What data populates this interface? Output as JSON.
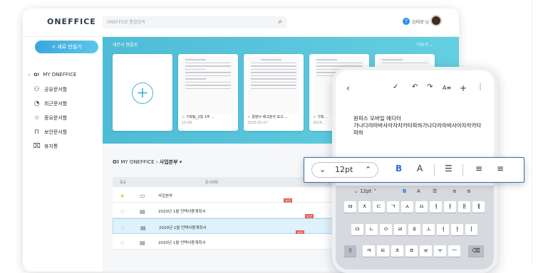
{
  "header": {
    "logo": "ONEFFICE",
    "search_placeholder": "ONEFFICE 통합검색",
    "user_name": "김태경 님"
  },
  "sidebar": {
    "new_button": "+ 새로 만들기",
    "items": [
      {
        "label": "MY ONEFFICE",
        "icon": "folder-icon"
      },
      {
        "label": "공유문서함",
        "icon": "users-icon"
      },
      {
        "label": "최근문서함",
        "icon": "clock-icon"
      },
      {
        "label": "중요문서함",
        "icon": "star-icon"
      },
      {
        "label": "보안문서함",
        "icon": "lock-icon"
      },
      {
        "label": "휴지통",
        "icon": "trash-icon"
      }
    ]
  },
  "templates": {
    "title": "새문서 템플릿",
    "more": "더보기",
    "cards": [
      {
        "caption": "기획팀_2월 1주 ...",
        "date": "15:09"
      },
      {
        "caption": "경영서 배고분석 보고 ...",
        "date": "2020.02.07"
      },
      {
        "caption": "기획...",
        "date": "2019..."
      }
    ]
  },
  "breadcrumb": {
    "root": "MY ONEFFICE",
    "current": "사업본부"
  },
  "table": {
    "headers": [
      "중요",
      "문서제목"
    ],
    "rows": [
      {
        "title": "사업본부",
        "starred": true,
        "type": "folder",
        "badges": [
          "공유",
          "보안"
        ],
        "selected": false
      },
      {
        "title": "2020년 1월 언택사용계획서",
        "starred": false,
        "type": "doc",
        "badges": [
          "보안"
        ],
        "selected": false
      },
      {
        "title": "2020년 1월 언택사용계획서",
        "starred": false,
        "type": "doc",
        "badges": [
          "공유",
          "보안"
        ],
        "selected": true
      },
      {
        "title": "2020년 1월 언택사용계획서",
        "starred": false,
        "type": "doc",
        "badges": [],
        "selected": false
      }
    ]
  },
  "mobile": {
    "text_line1": "원피스 모바일 에디터",
    "text_line2": "가나다라마바사아자차카타파하가나다라마바사아자차카타파하",
    "kbd_size": "12pt",
    "keys_row1": [
      "ㅂ",
      "ㅈ",
      "ㄷ",
      "ㄱ",
      "ㅅ",
      "ㅛ",
      "ㅕ",
      "ㅑ",
      "ㅐ",
      "ㅔ"
    ],
    "keys_row2": [
      "ㅁ",
      "ㄴ",
      "ㅇ",
      "ㄹ",
      "ㅎ",
      "ㅗ",
      "ㅓ",
      "ㅏ",
      "ㅣ"
    ],
    "keys_row3": [
      "ㅋ",
      "ㅌ",
      "ㅊ",
      "ㅍ",
      "ㅠ",
      "ㅜ",
      "ㅡ"
    ]
  },
  "format_bar": {
    "font_size": "12pt",
    "bold": "B",
    "font_color": "A"
  }
}
